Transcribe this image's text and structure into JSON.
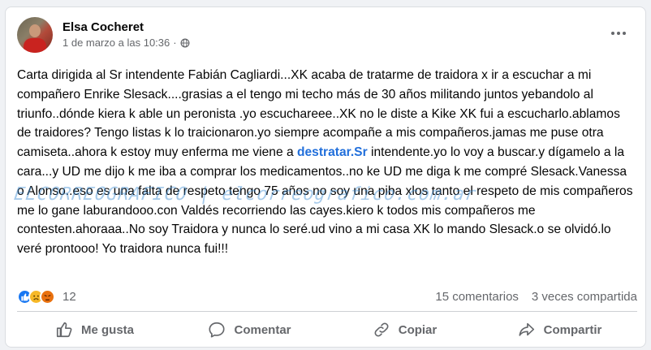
{
  "post": {
    "author": "Elsa Cocheret",
    "timestamp": "1 de marzo a las 10:36",
    "separator": "·",
    "audience_icon": "globe-icon",
    "text_before_link": "Carta dirigida al Sr intendente Fabián Cagliardi...XK acaba de tratarme de traidora x ir a escuchar a mi compañero Enrike Slesack....grasias a el tengo mi techo más de 30 años militando juntos yebandolo al triunfo..dónde kiera k able un peronista .yo escuchareee..XK no le diste a Kike XK fui a escucharlo.ablamos de traidores? Tengo listas k lo traicionaron.yo siempre acompañe a mis compañeros.jamas me puse otra camiseta..ahora k estoy muy enferma me viene a ",
    "link_text": "destratar.Sr",
    "text_after_link": " intendente.yo lo voy a buscar.y dígamelo a la cara...y UD me dijo k me iba a comprar los medicamentos..no ke UD me diga k me compré Slesack.Vanessa o Alonso..eso es una falta de respeto tengo 75 años no soy una piba xlos tanto el respeto de mis compañeros me lo gane laburandooo.con Valdés recorriendo las cayes.kiero k todos mis compañeros me contesten.ahoraaa..No soy Traidora y nunca lo seré.ud vino a mi casa XK lo mando Slesack.o se olvidó.lo veré prontooo! Yo traidora nunca fui!!!"
  },
  "watermark": "ELCORREOGRAFICO | elcorreografico.com.ar",
  "stats": {
    "reactions": [
      "like",
      "sad",
      "angry"
    ],
    "reaction_count": "12",
    "comments": "15 comentarios",
    "shares": "3 veces compartida"
  },
  "actions": {
    "like": "Me gusta",
    "comment": "Comentar",
    "copy": "Copiar",
    "share": "Compartir"
  },
  "colors": {
    "link": "#216fdb",
    "like_blue": "#1877f2",
    "secondary_text": "#65676b"
  }
}
